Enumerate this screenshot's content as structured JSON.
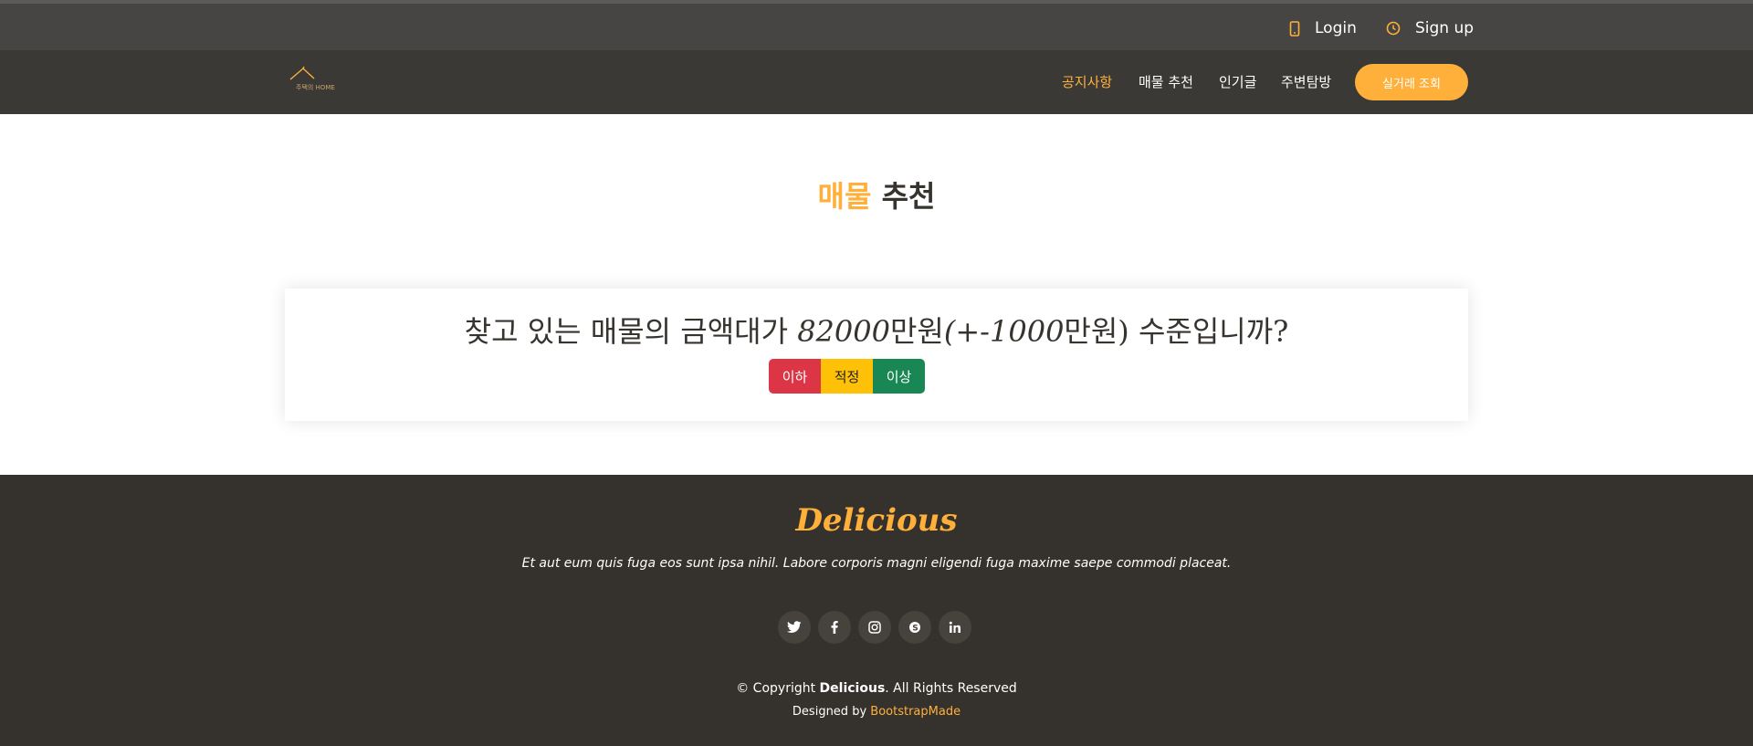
{
  "topbar": {
    "login_label": "Login",
    "signup_label": "Sign up",
    "login_icon": "phone-icon",
    "signup_icon": "clock-icon"
  },
  "header": {
    "logo_text": "주택의 HOME",
    "nav": [
      {
        "label": "공지사항",
        "active": true
      },
      {
        "label": "매물 추천",
        "active": false
      },
      {
        "label": "인기글",
        "active": false
      },
      {
        "label": "주변탐방",
        "active": false
      }
    ],
    "cta_label": "실거래 조회"
  },
  "section": {
    "title_accent": "매물",
    "title_rest": "추천"
  },
  "question": {
    "prefix": "찾고 있는 매물의 금액대가 ",
    "amount": "82000",
    "unit1": "만원",
    "range": "(+-1000",
    "unit2": "만원)",
    "suffix": " 수준입니까?"
  },
  "buttons": {
    "low": "이하",
    "mid": "적정",
    "high": "이상"
  },
  "footer": {
    "brand": "Delicious",
    "text": "Et aut eum quis fuga eos sunt ipsa nihil. Labore corporis magni eligendi fuga maxime saepe commodi placeat.",
    "socials": [
      "twitter-icon",
      "facebook-icon",
      "instagram-icon",
      "skype-icon",
      "linkedin-icon"
    ],
    "copyright_prefix": "© Copyright ",
    "copyright_brand": "Delicious",
    "copyright_suffix": ". All Rights Reserved",
    "designed_prefix": "Designed by ",
    "designed_link": "BootstrapMade"
  },
  "colors": {
    "accent": "#ffb03b",
    "danger": "#dc3545",
    "warning": "#ffc107",
    "success": "#198754",
    "dark": "#35322d"
  }
}
